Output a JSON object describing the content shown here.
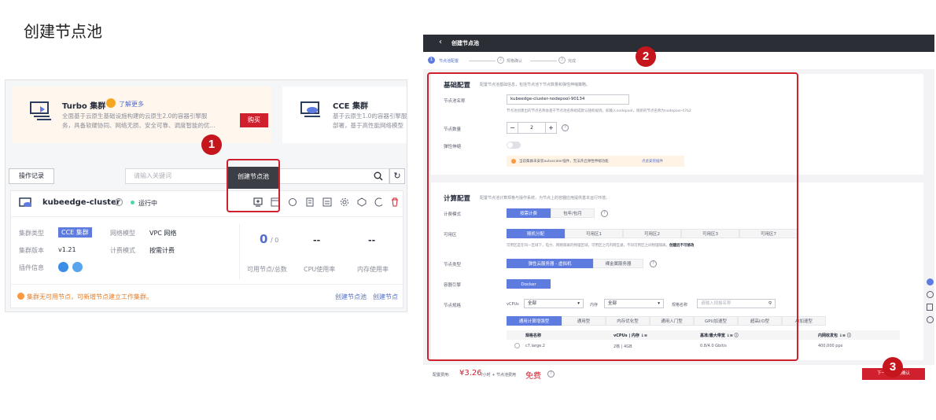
{
  "page_title": "创建节点池",
  "steps_badges": [
    "1",
    "2",
    "3"
  ],
  "left": {
    "turbo": {
      "title": "Turbo 集群",
      "learn_more": "了解更多",
      "desc1": "全面基于云原生基础设施构建的云原生2.0的容器引擎服",
      "desc2": "务，具备软硬协同、网络无损、安全可靠、调度智能的优...",
      "buy": "购买"
    },
    "cce": {
      "title": "CCE 集群",
      "desc1": "基于云原生1.0的容器引擎服",
      "desc2": "部署，基于高性能网络模型"
    },
    "op_log": "操作记录",
    "search_placeholder": "请输入关键词",
    "tooltip": "创建节点池",
    "cluster": {
      "name": "kubeedge-cluster",
      "status": "运行中",
      "type_label": "集群类型",
      "type_value": "CCE 集群",
      "net_label": "网络模型",
      "net_value": "VPC 网络",
      "version_label": "集群版本",
      "version_value": "v1.21",
      "billing_label": "计费模式",
      "billing_value": "按需计费",
      "plugin_label": "插件信息",
      "nodes_value": "0",
      "nodes_total": "/ 0",
      "nodes_label": "可用节点/总数",
      "cpu_value": "--",
      "cpu_label": "CPU使用率",
      "mem_value": "--",
      "mem_label": "内存使用率",
      "warning": "集群无可用节点，可新增节点建立工作集群。",
      "link_pool": "创建节点池",
      "link_node": "创建节点"
    }
  },
  "right": {
    "back_title": "创建节点池",
    "steps": [
      "节点池配置",
      "规格确认",
      "完成"
    ],
    "basic": {
      "title": "基础配置",
      "desc": "配置节点池基础信息，包括节点池下节点数量和弹性伸缩策略。",
      "name_label": "节点池名称",
      "name_value": "kubeedge-cluster-nodepool-90134",
      "name_hint": "节点池创建出的节点名称会基于节点池名称组成默认随机规则，如输入nodepool，则新的节点名称为nodepool-47b2",
      "count_label": "节点数量",
      "count_value": "2",
      "count_minus": "−",
      "count_plus": "+",
      "scale_label": "弹性伸缩",
      "scale_warning": "当前集群未安装autoscaler插件，无法开启弹性伸缩功能",
      "scale_link": "点此安装插件"
    },
    "compute": {
      "title": "计算配置",
      "desc": "配置节点池计算规格与操作系统，为节点上的容器应用提供基本运行环境。",
      "billing_label": "计费模式",
      "billing_options": [
        "按需计费",
        "包年/包月"
      ],
      "az_label": "可用区",
      "az_options": [
        "随机分配",
        "可用区1",
        "可用区2",
        "可用区3",
        "可用区7"
      ],
      "az_hint": "可用区是在同一区域下，电力、网络隔离的物理区域，可用区之内内网互通，不同可用区之间物理隔离。",
      "az_hint_bold": "创建后不可修改",
      "node_type_label": "节点类型",
      "node_type_options": [
        "弹性云服务器 - 虚拟机",
        "裸金属服务器"
      ],
      "engine_label": "容器引擎",
      "engine_option": "Docker",
      "spec_label": "节点规格",
      "vcpus_label": "vCPUs",
      "vcpus_value": "全部",
      "mem_label": "内存",
      "mem_value": "全部",
      "spec_name_label": "规格名称",
      "spec_name_placeholder": "请输入规格名称",
      "spec_tabs": [
        "通用计算增强型",
        "通用型",
        "内存优化型",
        "通用入门型",
        "GPU加速型",
        "超高I/O型",
        "AI加速型"
      ],
      "table_headers": [
        "规格名称",
        "vCPUs | 内存 ↓≡",
        "基准/最大带宽 ↓≡ ⓘ",
        "内网收发包 ↓≡ ⓘ"
      ],
      "table_row": [
        "c7.large.2",
        "2核 | 4GB",
        "0.8/4.0 Gbit/s",
        "400,000 pps"
      ]
    },
    "footer": {
      "config_label": "配置费用:",
      "price": "¥3.26",
      "price_unit": "/小时 + 节点池费用",
      "free": "免费",
      "next_btn": "下一步: 规格确认"
    }
  }
}
